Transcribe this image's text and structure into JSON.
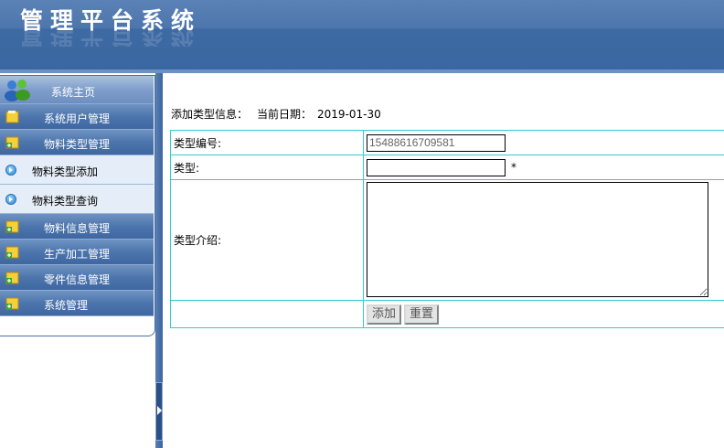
{
  "header": {
    "title": "管理平台系统"
  },
  "sidebar": {
    "home": {
      "label": "系统主页",
      "icon": "users-icon"
    },
    "items": [
      {
        "label": "系统用户管理",
        "icon": "folder-icon"
      },
      {
        "label": "物料类型管理",
        "icon": "folder-add-icon"
      },
      {
        "label": "物料类型添加",
        "icon": "arrow-circle-icon",
        "sub": true
      },
      {
        "label": "物料类型查询",
        "icon": "arrow-circle-icon",
        "sub": true
      },
      {
        "label": "物料信息管理",
        "icon": "folder-add-icon"
      },
      {
        "label": "生产加工管理",
        "icon": "folder-add-icon"
      },
      {
        "label": "零件信息管理",
        "icon": "folder-add-icon"
      },
      {
        "label": "系统管理",
        "icon": "folder-add-icon"
      }
    ]
  },
  "main": {
    "heading": "添加类型信息：",
    "date_label": "当前日期：",
    "date_value": "2019-01-30",
    "form": {
      "code_label": "类型编号:",
      "code_value": "15488616709581",
      "type_label": "类型:",
      "type_value": "",
      "required_mark": "*",
      "intro_label": "类型介绍:",
      "intro_value": "",
      "add_button": "添加",
      "reset_button": "重置"
    }
  },
  "colors": {
    "header_blue": "#3e6aa4",
    "menu_blue": "#4c75ad",
    "table_border": "#33cccc"
  }
}
